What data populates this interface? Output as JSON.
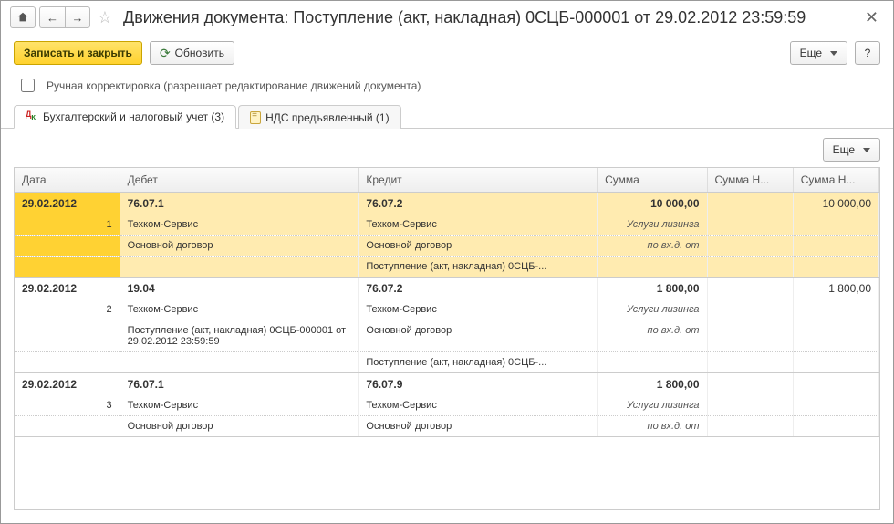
{
  "header": {
    "title": "Движения документа: Поступление (акт, накладная) 0СЦБ-000001 от 29.02.2012 23:59:59"
  },
  "toolbar": {
    "save_close": "Записать и закрыть",
    "refresh": "Обновить",
    "more": "Еще",
    "help": "?"
  },
  "checkbox": {
    "label": "Ручная корректировка (разрешает редактирование движений документа)"
  },
  "tabs": {
    "accounting": "Бухгалтерский и налоговый учет (3)",
    "vat": "НДС предъявленный (1)"
  },
  "inner": {
    "more": "Еще"
  },
  "grid": {
    "columns": {
      "date": "Дата",
      "debit": "Дебет",
      "credit": "Кредит",
      "sum": "Сумма",
      "sum_n1": "Сумма Н...",
      "sum_n2": "Сумма Н..."
    },
    "rows": [
      {
        "selected": true,
        "date": "29.02.2012",
        "n": "1",
        "debit_acc": "76.07.1",
        "credit_acc": "76.07.2",
        "sum": "10 000,00",
        "sum_n2": "10 000,00",
        "debit_lines": [
          "Техком-Сервис",
          "Основной договор"
        ],
        "credit_lines": [
          "Техком-Сервис",
          "Основной договор",
          "Поступление (акт, накладная) 0СЦБ-..."
        ],
        "desc": [
          "Услуги лизинга",
          "по вх.д.  от"
        ]
      },
      {
        "date": "29.02.2012",
        "n": "2",
        "debit_acc": "19.04",
        "credit_acc": "76.07.2",
        "sum": "1 800,00",
        "sum_n2": "1 800,00",
        "debit_lines": [
          "Техком-Сервис",
          "Поступление (акт, накладная) 0СЦБ-000001 от 29.02.2012 23:59:59"
        ],
        "credit_lines": [
          "Техком-Сервис",
          "Основной договор",
          "Поступление (акт, накладная) 0СЦБ-..."
        ],
        "desc": [
          "Услуги лизинга",
          "по вх.д.  от"
        ]
      },
      {
        "date": "29.02.2012",
        "n": "3",
        "debit_acc": "76.07.1",
        "credit_acc": "76.07.9",
        "sum": "1 800,00",
        "sum_n2": "",
        "debit_lines": [
          "Техком-Сервис",
          "Основной договор"
        ],
        "credit_lines": [
          "Техком-Сервис",
          "Основной договор"
        ],
        "desc": [
          "Услуги лизинга",
          "по вх.д.  от"
        ]
      }
    ]
  }
}
